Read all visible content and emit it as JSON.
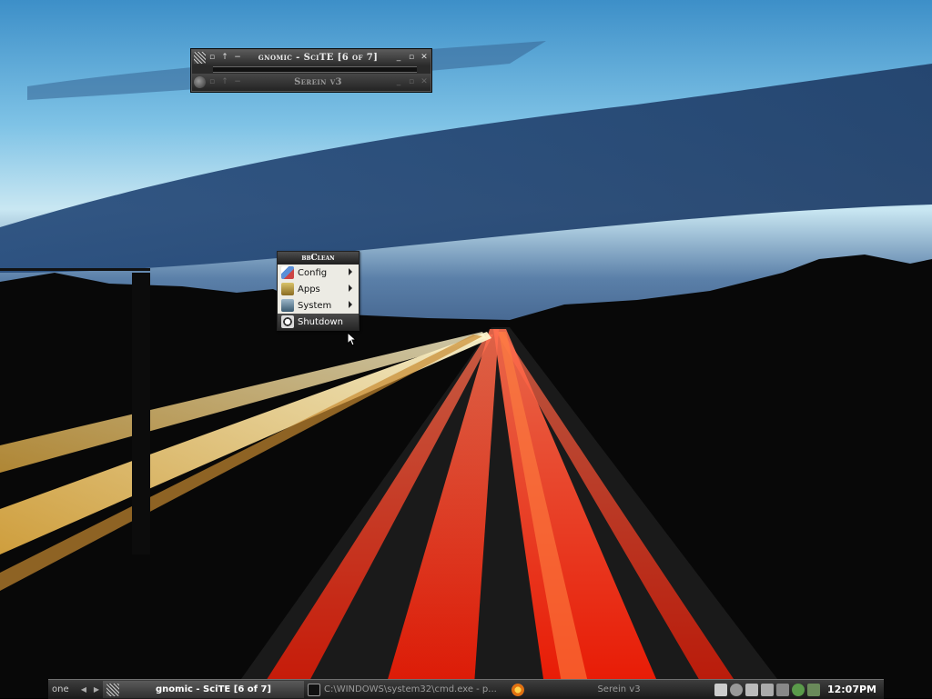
{
  "window": {
    "title_top": "gnomic - SciTE [6 of 7]",
    "title_bottom": "Serein v3",
    "btn_up": "↑",
    "btn_dash": "−",
    "btn_min": "_",
    "btn_max": "▫",
    "btn_close": "✕"
  },
  "menu": {
    "title": "bbClean",
    "items": [
      {
        "label": "Config",
        "icon": "config-icon"
      },
      {
        "label": "Apps",
        "icon": "apps-icon"
      },
      {
        "label": "System",
        "icon": "system-icon"
      },
      {
        "label": "Shutdown",
        "icon": "power-icon"
      }
    ]
  },
  "taskbar": {
    "workspace": "one",
    "prev": "◀",
    "next": "▶",
    "tasks": [
      {
        "label": "gnomic - SciTE [6 of 7]",
        "icon": "scite-icon",
        "active": true
      },
      {
        "label": "C:\\WINDOWS\\system32\\cmd.exe - p...",
        "icon": "cmd-icon",
        "active": false
      },
      {
        "label": "Serein v3",
        "icon": "firefox-icon",
        "active": false
      }
    ],
    "tray": [
      "calendar-icon",
      "drive-icon",
      "network-icon",
      "tools-icon",
      "volume-icon",
      "utorrent-icon",
      "app-icon"
    ],
    "clock": "12:07PM"
  }
}
